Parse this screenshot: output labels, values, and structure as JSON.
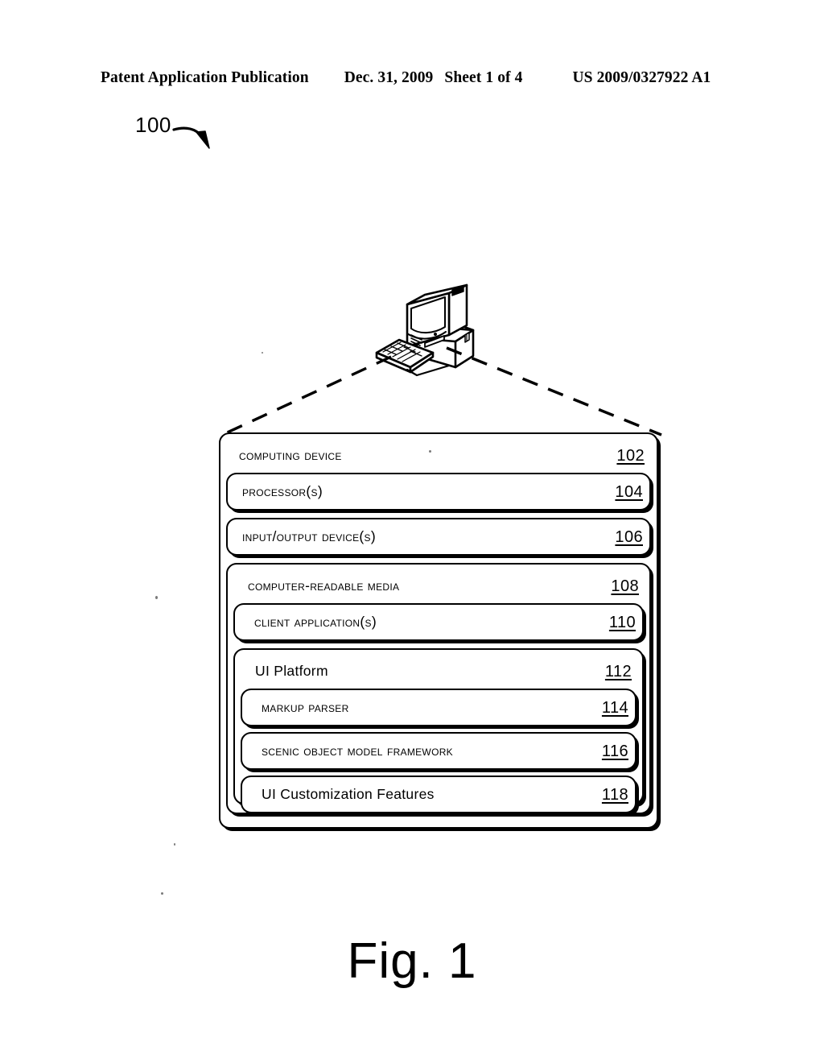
{
  "header": {
    "publication": "Patent Application Publication",
    "date": "Dec. 31, 2009",
    "sheet": "Sheet 1 of 4",
    "doc_number": "US 2009/0327922 A1"
  },
  "figure": {
    "callout_number": "100",
    "caption": "Fig. 1",
    "illustration": "desktop-computer"
  },
  "diagram": {
    "type": "nested-block-diagram",
    "blocks": [
      {
        "id": "computing-device",
        "label": "Computing Device",
        "ref": "102",
        "level": 0,
        "children": [
          {
            "id": "processors",
            "label": "Processor(s)",
            "ref": "104",
            "level": 1,
            "children": []
          },
          {
            "id": "input-output-devices",
            "label": "Input/Output device(s)",
            "ref": "106",
            "level": 1,
            "children": []
          },
          {
            "id": "computer-readable-media",
            "label": "Computer-Readable Media",
            "ref": "108",
            "level": 1,
            "children": [
              {
                "id": "client-applications",
                "label": "Client Application(s)",
                "ref": "110",
                "level": 2,
                "children": []
              },
              {
                "id": "ui-platform",
                "label": "UI Platform",
                "ref": "112",
                "level": 2,
                "children": [
                  {
                    "id": "markup-parser",
                    "label": "Markup Parser",
                    "ref": "114",
                    "level": 3,
                    "children": []
                  },
                  {
                    "id": "scenic-object-model-framework",
                    "label": "Scenic Object Model Framework",
                    "ref": "116",
                    "level": 3,
                    "children": []
                  },
                  {
                    "id": "ui-customization-features",
                    "label": "UI Customization Features",
                    "ref": "118",
                    "level": 3,
                    "children": []
                  }
                ]
              }
            ]
          }
        ]
      }
    ]
  },
  "colors": {
    "ink": "#000000",
    "paper": "#ffffff",
    "speck": "#7a7a7a"
  }
}
